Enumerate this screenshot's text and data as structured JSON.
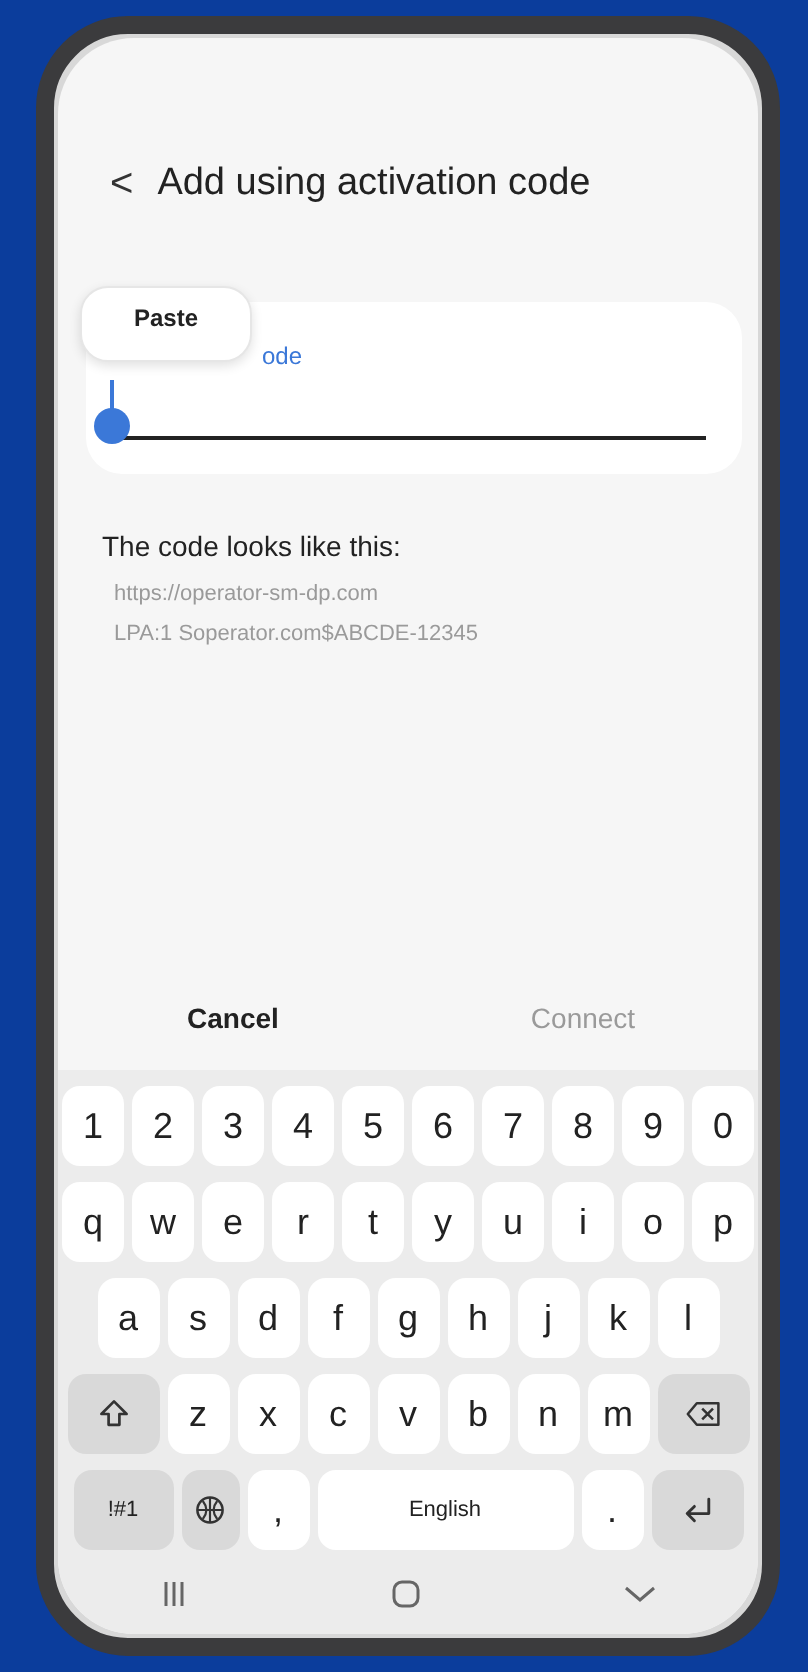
{
  "header": {
    "back": "<",
    "title": "Add using activation code"
  },
  "field": {
    "label": "ode",
    "focused": true
  },
  "popup": {
    "label": "Paste"
  },
  "hint": {
    "heading": "The code looks like this:",
    "examples": [
      "https://operator-sm-dp.com",
      "LPA:1 Soperator.com$ABCDE-12345"
    ]
  },
  "actions": [
    {
      "label": "Cancel",
      "disabled": false
    },
    {
      "label": "Connect",
      "disabled": true
    }
  ],
  "keyboard": [
    [
      {
        "kind": "char",
        "label": "1"
      },
      {
        "kind": "char",
        "label": "2"
      },
      {
        "kind": "char",
        "label": "3"
      },
      {
        "kind": "char",
        "label": "4"
      },
      {
        "kind": "char",
        "label": "5"
      },
      {
        "kind": "char",
        "label": "6"
      },
      {
        "kind": "char",
        "label": "7"
      },
      {
        "kind": "char",
        "label": "8"
      },
      {
        "kind": "char",
        "label": "9"
      },
      {
        "kind": "char",
        "label": "0"
      }
    ],
    [
      {
        "kind": "char",
        "label": "q"
      },
      {
        "kind": "char",
        "label": "w"
      },
      {
        "kind": "char",
        "label": "e"
      },
      {
        "kind": "char",
        "label": "r"
      },
      {
        "kind": "char",
        "label": "t"
      },
      {
        "kind": "char",
        "label": "y"
      },
      {
        "kind": "char",
        "label": "u"
      },
      {
        "kind": "char",
        "label": "i"
      },
      {
        "kind": "char",
        "label": "o"
      },
      {
        "kind": "char",
        "label": "p"
      }
    ],
    [
      {
        "kind": "char",
        "label": "a"
      },
      {
        "kind": "char",
        "label": "s"
      },
      {
        "kind": "char",
        "label": "d"
      },
      {
        "kind": "char",
        "label": "f"
      },
      {
        "kind": "char",
        "label": "g"
      },
      {
        "kind": "char",
        "label": "h"
      },
      {
        "kind": "char",
        "label": "j"
      },
      {
        "kind": "char",
        "label": "k"
      },
      {
        "kind": "char",
        "label": "l"
      }
    ],
    [
      {
        "kind": "shift"
      },
      {
        "kind": "char",
        "label": "z"
      },
      {
        "kind": "char",
        "label": "x"
      },
      {
        "kind": "char",
        "label": "c"
      },
      {
        "kind": "char",
        "label": "v"
      },
      {
        "kind": "char",
        "label": "b"
      },
      {
        "kind": "char",
        "label": "n"
      },
      {
        "kind": "char",
        "label": "m"
      },
      {
        "kind": "backspace"
      }
    ],
    [
      {
        "kind": "symbols",
        "label": "!#1"
      },
      {
        "kind": "globe"
      },
      {
        "kind": "char",
        "label": ","
      },
      {
        "kind": "space",
        "label": "English"
      },
      {
        "kind": "char",
        "label": "."
      },
      {
        "kind": "enter"
      }
    ]
  ]
}
